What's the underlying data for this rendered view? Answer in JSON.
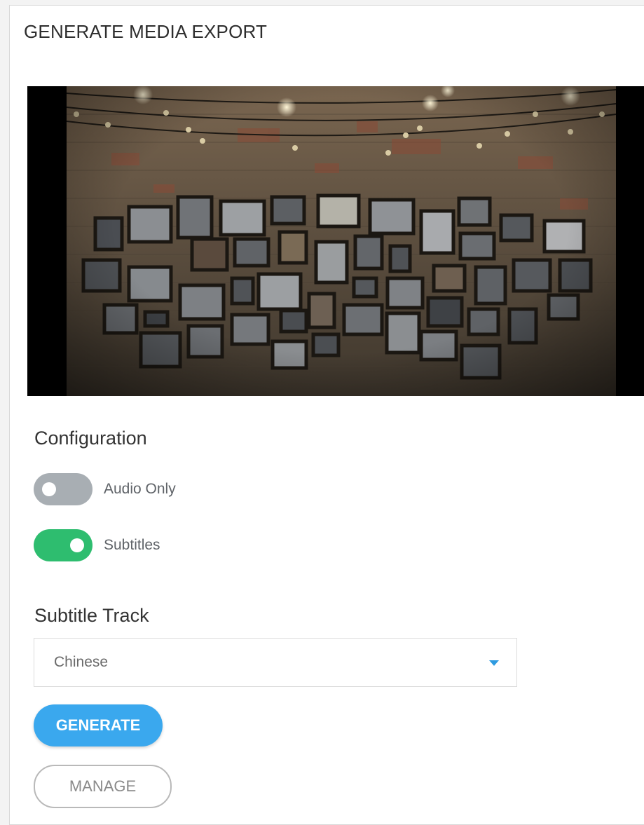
{
  "panel": {
    "title": "GENERATE MEDIA EXPORT"
  },
  "preview": {
    "description_icon": "video-thumbnail"
  },
  "configuration": {
    "heading": "Configuration",
    "audio_only": {
      "label": "Audio Only",
      "enabled": false
    },
    "subtitles": {
      "label": "Subtitles",
      "enabled": true
    }
  },
  "subtitle_track": {
    "heading": "Subtitle Track",
    "selected": "Chinese"
  },
  "actions": {
    "generate_label": "GENERATE",
    "manage_label": "MANAGE"
  },
  "colors": {
    "accent_blue": "#3aa8ee",
    "toggle_on": "#2ebd6f",
    "toggle_off": "#a8aeb3"
  }
}
